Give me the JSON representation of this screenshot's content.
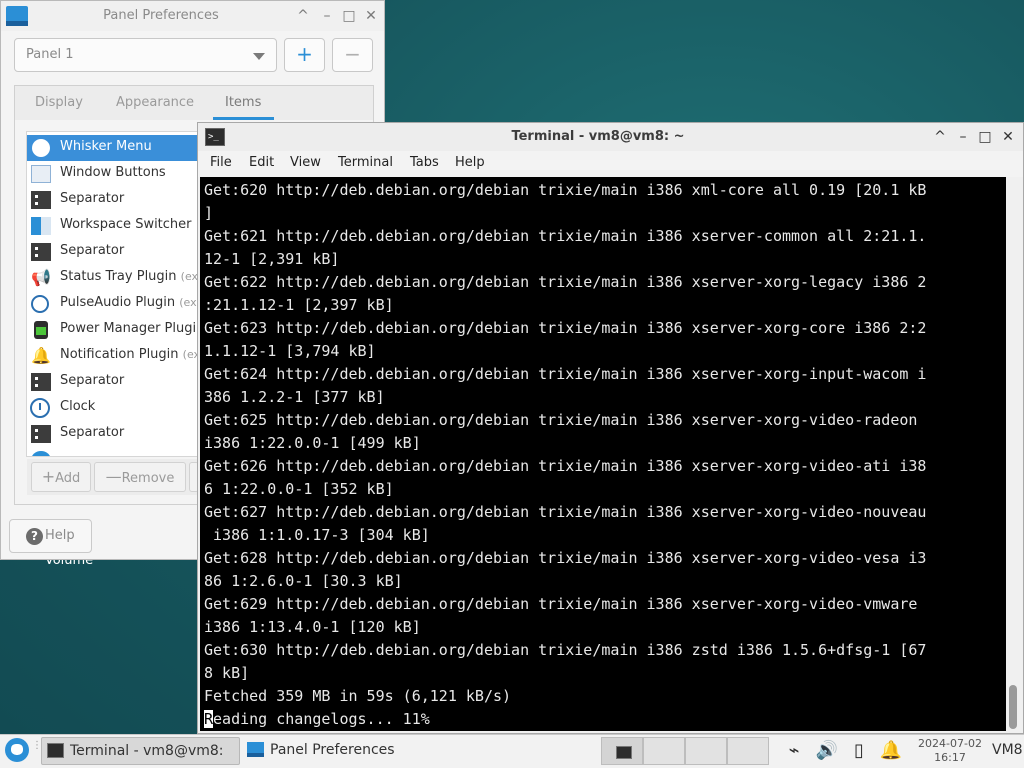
{
  "desktop": {
    "label": "Volume"
  },
  "panel_prefs": {
    "title": "Panel Preferences",
    "panel_select": "Panel 1",
    "add_panel": "+",
    "remove_panel": "−",
    "tabs": [
      "Display",
      "Appearance",
      "Items"
    ],
    "active_tab": "Items",
    "items": [
      {
        "label": "Whisker Menu",
        "ext": "",
        "icon": "whisker-menu-icon",
        "selected": true
      },
      {
        "label": "Window Buttons",
        "ext": "",
        "icon": "window-buttons-icon"
      },
      {
        "label": "Separator",
        "ext": "",
        "icon": "separator-icon"
      },
      {
        "label": "Workspace Switcher",
        "ext": "",
        "icon": "workspace-switcher-icon"
      },
      {
        "label": "Separator",
        "ext": "",
        "icon": "separator-icon"
      },
      {
        "label": "Status Tray Plugin",
        "ext": "(ex",
        "icon": "megaphone-icon"
      },
      {
        "label": "PulseAudio Plugin",
        "ext": "(ex",
        "icon": "audio-icon"
      },
      {
        "label": "Power Manager Plugi",
        "ext": "",
        "icon": "battery-icon"
      },
      {
        "label": "Notification Plugin",
        "ext": "(ex",
        "icon": "bell-icon"
      },
      {
        "label": "Separator",
        "ext": "",
        "icon": "separator-icon"
      },
      {
        "label": "Clock",
        "ext": "",
        "icon": "clock-icon"
      },
      {
        "label": "Separator",
        "ext": "",
        "icon": "separator-icon"
      }
    ],
    "add_btn": "Add",
    "remove_btn": "Remove",
    "help_btn": "Help"
  },
  "terminal": {
    "title": "Terminal - vm8@vm8: ~",
    "menu": [
      "File",
      "Edit",
      "View",
      "Terminal",
      "Tabs",
      "Help"
    ],
    "lines": [
      "Get:620 http://deb.debian.org/debian trixie/main i386 xml-core all 0.19 [20.1 kB",
      "]",
      "Get:621 http://deb.debian.org/debian trixie/main i386 xserver-common all 2:21.1.",
      "12-1 [2,391 kB]",
      "Get:622 http://deb.debian.org/debian trixie/main i386 xserver-xorg-legacy i386 2",
      ":21.1.12-1 [2,397 kB]",
      "Get:623 http://deb.debian.org/debian trixie/main i386 xserver-xorg-core i386 2:2",
      "1.1.12-1 [3,794 kB]",
      "Get:624 http://deb.debian.org/debian trixie/main i386 xserver-xorg-input-wacom i",
      "386 1.2.2-1 [377 kB]",
      "Get:625 http://deb.debian.org/debian trixie/main i386 xserver-xorg-video-radeon",
      "i386 1:22.0.0-1 [499 kB]",
      "Get:626 http://deb.debian.org/debian trixie/main i386 xserver-xorg-video-ati i38",
      "6 1:22.0.0-1 [352 kB]",
      "Get:627 http://deb.debian.org/debian trixie/main i386 xserver-xorg-video-nouveau",
      " i386 1:1.0.17-3 [304 kB]",
      "Get:628 http://deb.debian.org/debian trixie/main i386 xserver-xorg-video-vesa i3",
      "86 1:2.6.0-1 [30.3 kB]",
      "Get:629 http://deb.debian.org/debian trixie/main i386 xserver-xorg-video-vmware",
      "i386 1:13.4.0-1 [120 kB]",
      "Get:630 http://deb.debian.org/debian trixie/main i386 zstd i386 1.5.6+dfsg-1 [67",
      "8 kB]",
      "Fetched 359 MB in 59s (6,121 kB/s)"
    ],
    "last_line_cursor": "R",
    "last_line_rest": "eading changelogs... 11%"
  },
  "taskbar": {
    "tasks": [
      {
        "label": "Terminal - vm8@vm8: ~",
        "active": true
      },
      {
        "label": "Panel Preferences",
        "active": false
      }
    ],
    "date": "2024-07-02",
    "time": "16:17",
    "user": "VM8"
  }
}
